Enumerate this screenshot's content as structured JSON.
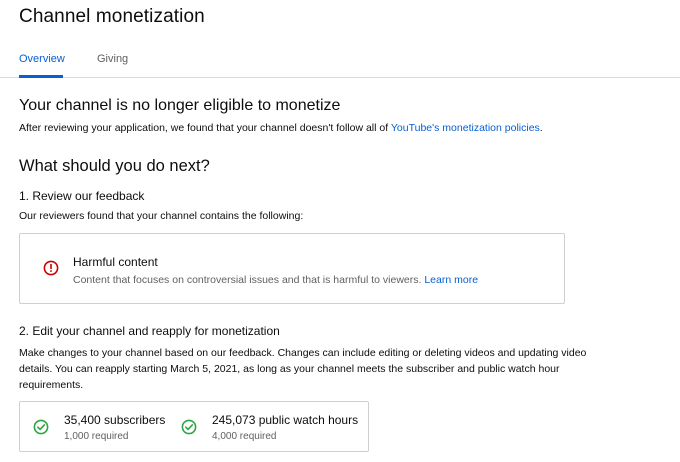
{
  "header": {
    "title": "Channel monetization"
  },
  "tabs": [
    {
      "label": "Overview",
      "active": true
    },
    {
      "label": "Giving",
      "active": false
    }
  ],
  "status": {
    "heading": "Your channel is no longer eligible to monetize",
    "description_prefix": "After reviewing your application, we found that your channel doesn't follow all of ",
    "policy_link": "YouTube's monetization policies",
    "description_suffix": "."
  },
  "next_steps": {
    "heading": "What should you do next?"
  },
  "step1": {
    "heading": "1. Review our feedback",
    "description": "Our reviewers found that your channel contains the following:",
    "feedback": {
      "icon": "error-circle-icon",
      "title": "Harmful content",
      "description": "Content that focuses on controversial issues and that is harmful to viewers. ",
      "learn_more": "Learn more"
    }
  },
  "step2": {
    "heading": "2. Edit your channel and reapply for monetization",
    "description": "Make changes to your channel based on our feedback. Changes can include editing or deleting videos and updating video details. You can reapply starting March 5, 2021, as long as your channel meets the subscriber and public watch hour requirements."
  },
  "requirements": [
    {
      "icon": "check-circle-icon",
      "value": "35,400 subscribers",
      "required": "1,000 required"
    },
    {
      "icon": "check-circle-icon",
      "value": "245,073 public watch hours",
      "required": "4,000 required"
    }
  ],
  "colors": {
    "accent": "#065fd4",
    "error": "#cc0000",
    "success": "#2ba640",
    "secondary_text": "#606060"
  }
}
